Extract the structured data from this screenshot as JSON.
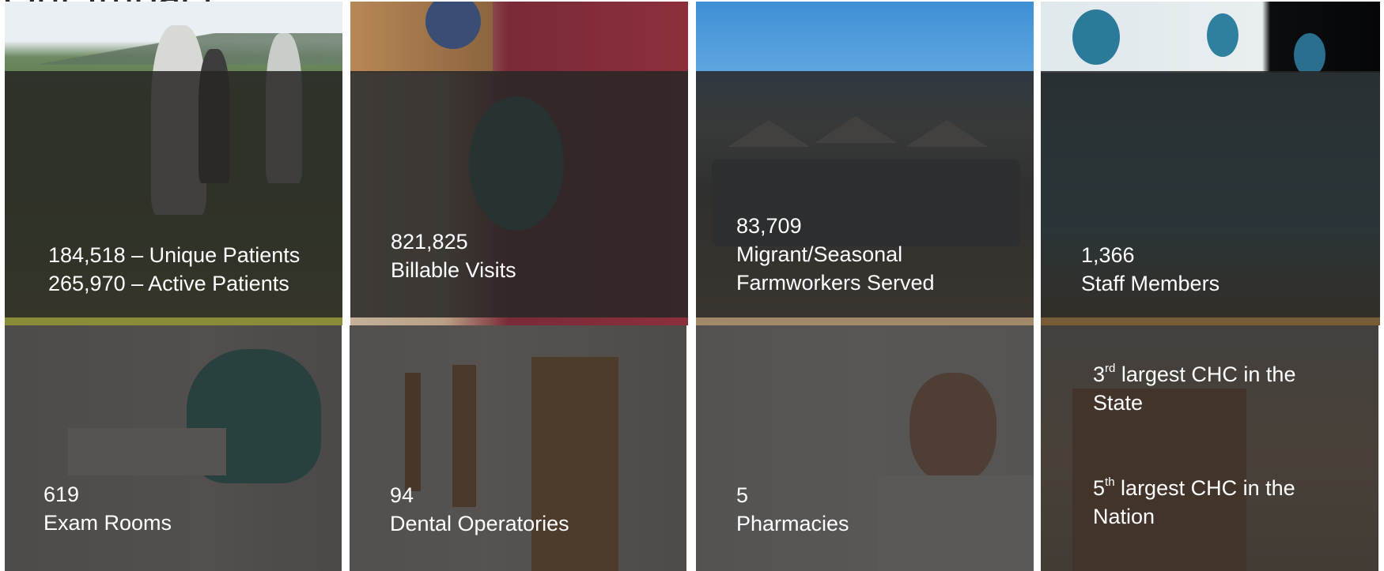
{
  "slide": {
    "title": "Our Impact"
  },
  "tiles": {
    "patients": {
      "line1": "184,518 – Unique Patients",
      "line2": "265,970 – Active Patients"
    },
    "visits": {
      "number": "821,825",
      "label": "Billable Visits"
    },
    "farmworkers": {
      "number": "83,709",
      "label_line1": "Migrant/Seasonal",
      "label_line2": "Farmworkers Served"
    },
    "staff": {
      "number": "1,366",
      "label": "Staff Members"
    },
    "exam_rooms": {
      "number": "619",
      "label": "Exam Rooms"
    },
    "dental": {
      "number": "94",
      "label": "Dental Operatories"
    },
    "pharmacies": {
      "number": "5",
      "label": "Pharmacies"
    },
    "rankings": {
      "state_num": "3",
      "state_suffix": "rd",
      "state_text": " largest CHC in the",
      "state_text2": "State",
      "nation_num": "5",
      "nation_suffix": "th",
      "nation_text": " largest CHC in the",
      "nation_text2": "Nation"
    }
  }
}
